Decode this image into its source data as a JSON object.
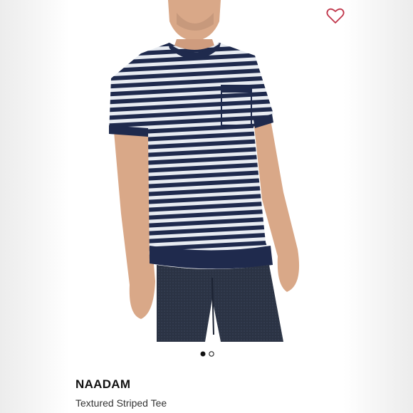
{
  "product": {
    "brand": "NAADAM",
    "name": "Textured Striped Tee"
  },
  "gallery": {
    "image_count": 2,
    "active_index": 0
  },
  "icons": {
    "favorite": "heart-outline-icon"
  },
  "colors": {
    "heart": "#c0354a",
    "shirt_navy": "#1f2a4d",
    "shirt_stripe": "#e8ecf2",
    "jeans": "#2b3344",
    "skin": "#d9a888"
  }
}
